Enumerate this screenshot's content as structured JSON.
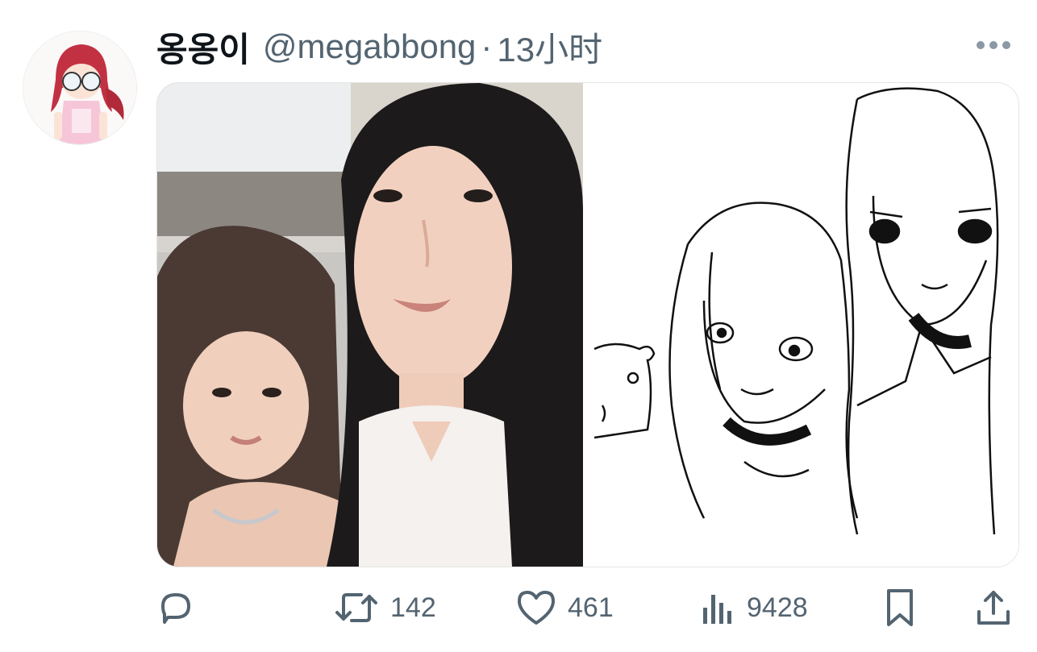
{
  "tweet": {
    "author": {
      "display_name": "옹옹이",
      "handle": "@megabbong"
    },
    "separator": "·",
    "time": "13小时"
  },
  "actions": {
    "retweets": "142",
    "likes": "461",
    "views": "9428"
  },
  "colors": {
    "text_primary": "#0f1419",
    "text_secondary": "#536471"
  }
}
